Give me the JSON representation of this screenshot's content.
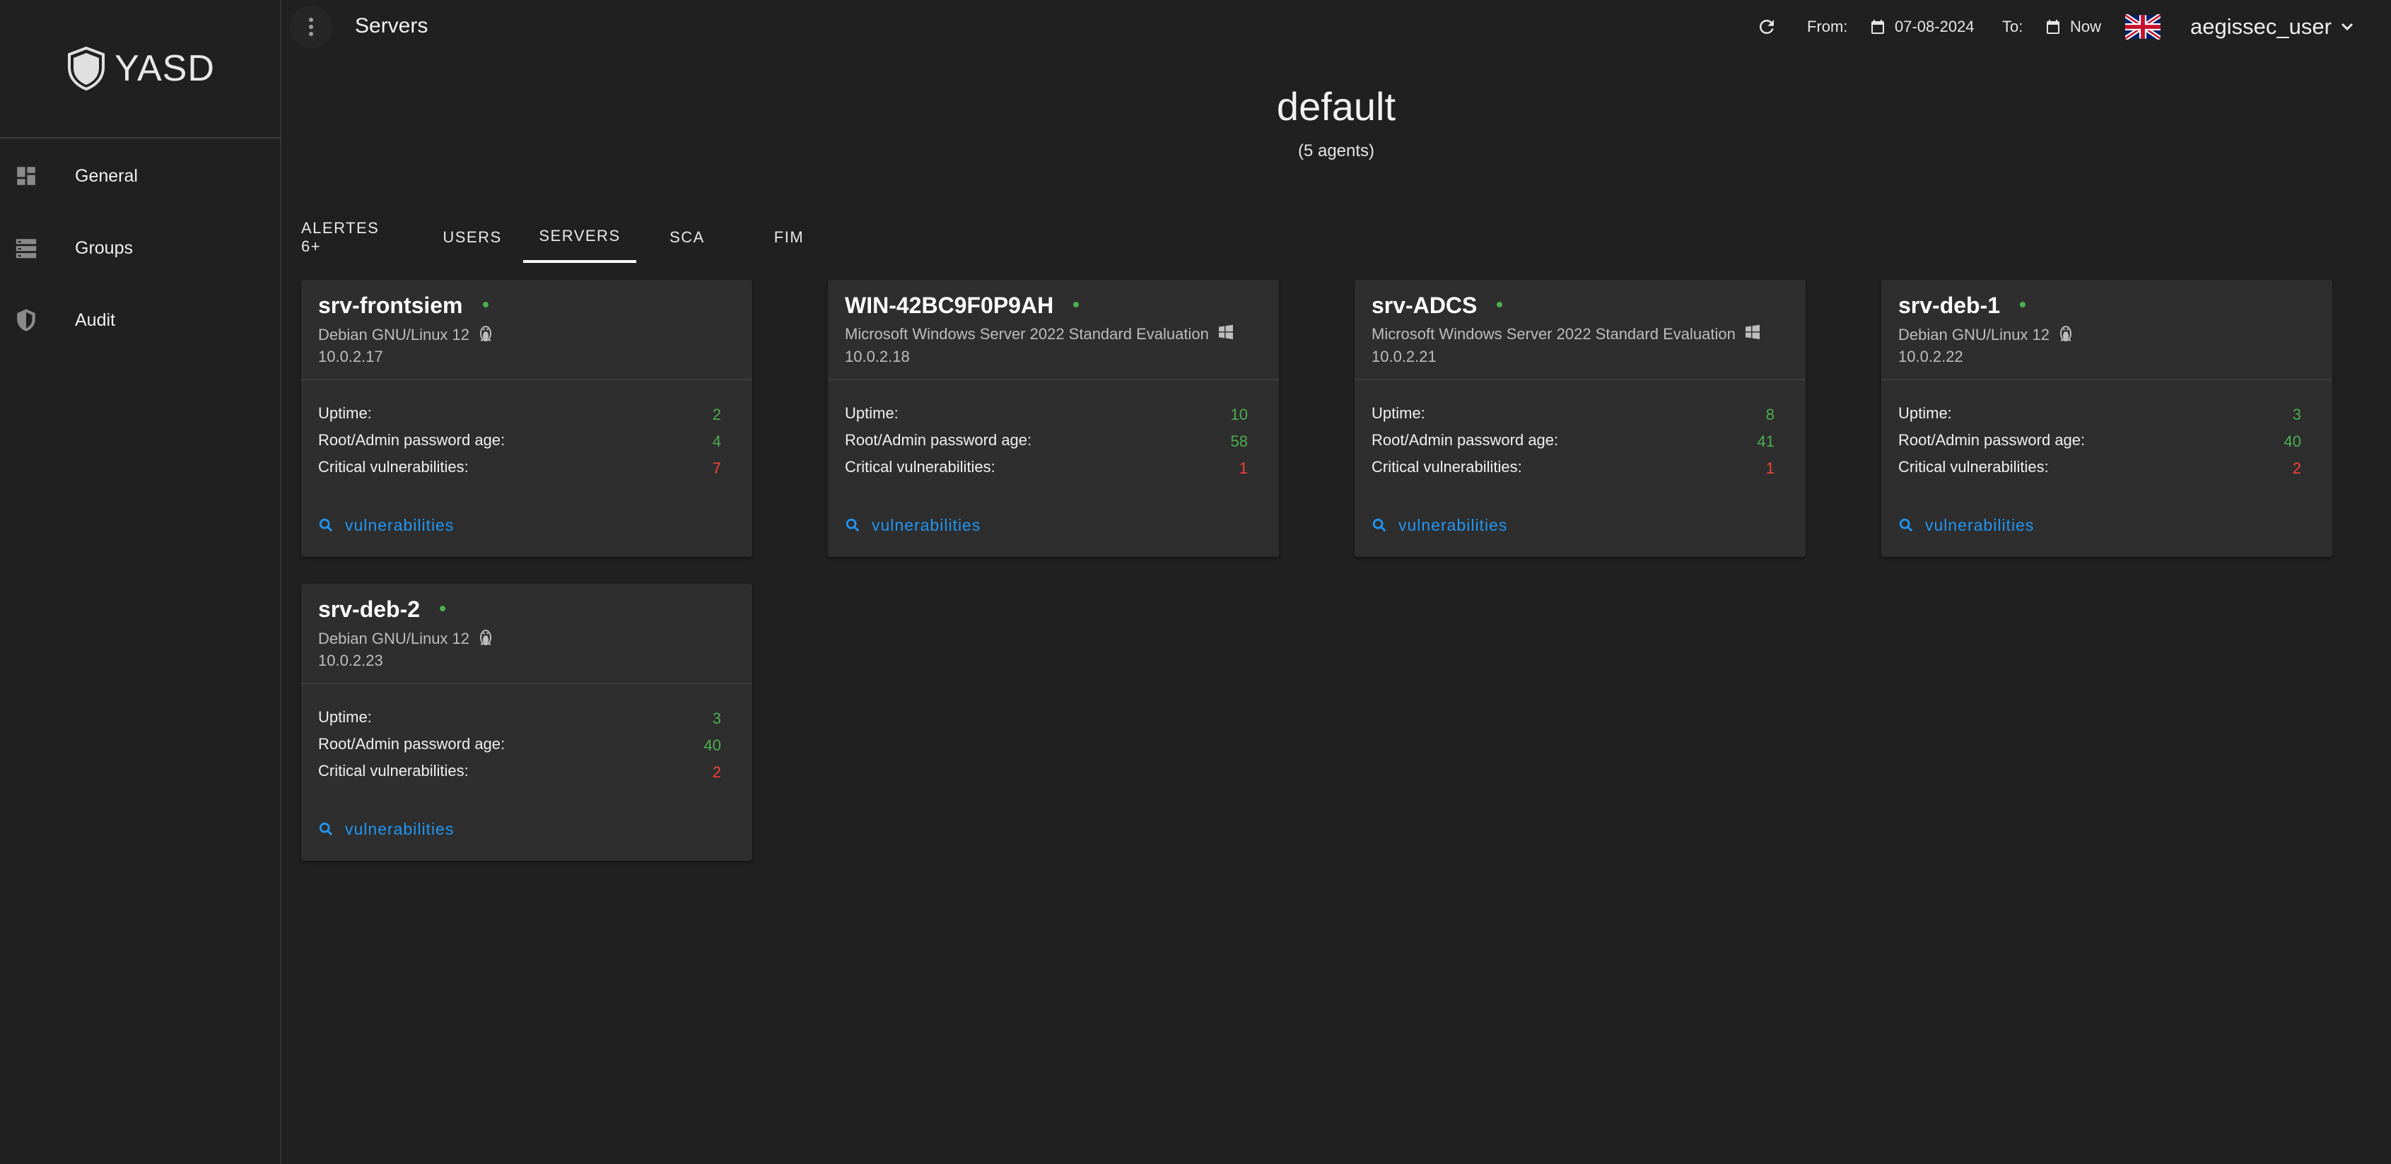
{
  "app": {
    "logo_text": "YASD"
  },
  "sidebar": {
    "items": [
      {
        "label": "General",
        "icon": "dashboard-icon"
      },
      {
        "label": "Groups",
        "icon": "server-list-icon"
      },
      {
        "label": "Audit",
        "icon": "shield-icon"
      }
    ]
  },
  "header": {
    "title": "Servers",
    "from_label": "From:",
    "from_value": "07-08-2024",
    "to_label": "To:",
    "to_value": "Now",
    "language_icon": "uk-flag-icon",
    "user": "aegissec_user"
  },
  "group": {
    "name": "default",
    "agent_count": "(5 agents)"
  },
  "tabs": [
    {
      "label": "ALERTES 6+",
      "active": false
    },
    {
      "label": "USERS",
      "active": false
    },
    {
      "label": "SERVERS",
      "active": true
    },
    {
      "label": "SCA",
      "active": false
    },
    {
      "label": "FIM",
      "active": false
    }
  ],
  "metric_labels": {
    "uptime": "Uptime:",
    "password_age": "Root/Admin password age:",
    "critical": "Critical vulnerabilities:"
  },
  "vulnerabilities_label": "vulnerabilities",
  "servers": [
    {
      "name": "srv-frontsiem",
      "os": "Debian GNU/Linux 12",
      "os_icon": "linux-icon",
      "ip": "10.0.2.17",
      "uptime": "2",
      "password_age": "4",
      "critical": "7"
    },
    {
      "name": "WIN-42BC9F0P9AH",
      "os": "Microsoft Windows Server 2022 Standard Evaluation",
      "os_icon": "windows-icon",
      "ip": "10.0.2.18",
      "uptime": "10",
      "password_age": "58",
      "critical": "1"
    },
    {
      "name": "srv-ADCS",
      "os": "Microsoft Windows Server 2022 Standard Evaluation",
      "os_icon": "windows-icon",
      "ip": "10.0.2.21",
      "uptime": "8",
      "password_age": "41",
      "critical": "1"
    },
    {
      "name": "srv-deb-1",
      "os": "Debian GNU/Linux 12",
      "os_icon": "linux-icon",
      "ip": "10.0.2.22",
      "uptime": "3",
      "password_age": "40",
      "critical": "2"
    },
    {
      "name": "srv-deb-2",
      "os": "Debian GNU/Linux 12",
      "os_icon": "linux-icon",
      "ip": "10.0.2.23",
      "uptime": "3",
      "password_age": "40",
      "critical": "2"
    }
  ],
  "colors": {
    "status_online": "#4caf50",
    "ok": "#4caf50",
    "critical": "#f44336",
    "link": "#2196f3"
  }
}
